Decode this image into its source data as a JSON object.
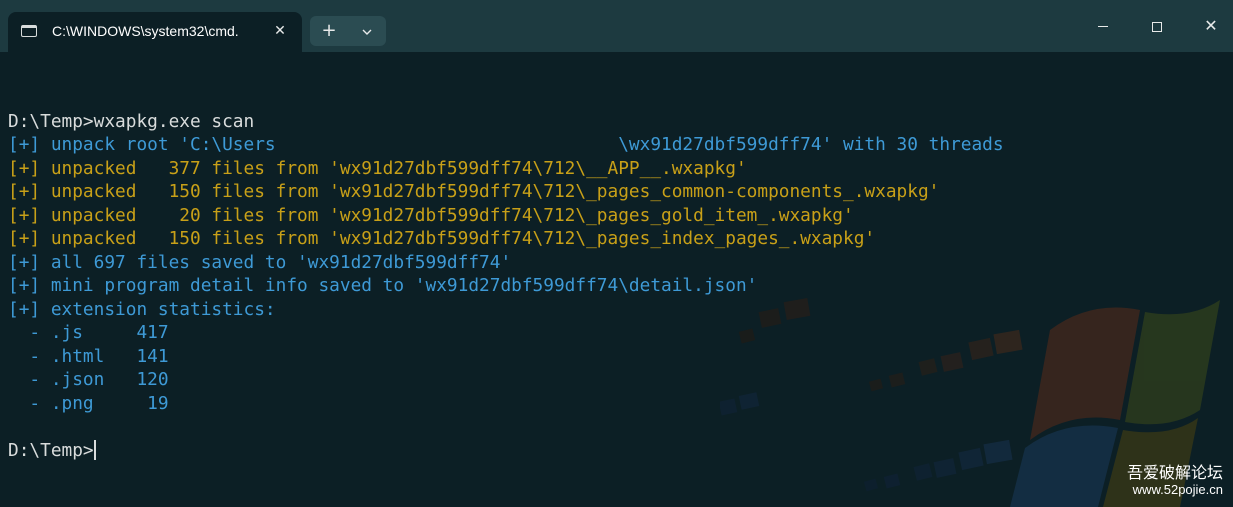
{
  "window": {
    "tab_title": "C:\\WINDOWS\\system32\\cmd.",
    "tab_close_glyph": "✕",
    "new_tab_glyph": "+",
    "dropdown_glyph": "⌄",
    "close_glyph": "✕"
  },
  "terminal": {
    "lines": [
      {
        "text": "",
        "color": "white"
      },
      {
        "text": "D:\\Temp>wxapkg.exe scan",
        "color": "white"
      },
      {
        "text": "[+] unpack root 'C:\\Users                                \\wx91d27dbf599dff74' with 30 threads",
        "color": "blue"
      },
      {
        "text": "[+] unpacked   377 files from 'wx91d27dbf599dff74\\712\\__APP__.wxapkg'",
        "color": "yellow"
      },
      {
        "text": "[+] unpacked   150 files from 'wx91d27dbf599dff74\\712\\_pages_common-components_.wxapkg'",
        "color": "yellow"
      },
      {
        "text": "[+] unpacked    20 files from 'wx91d27dbf599dff74\\712\\_pages_gold_item_.wxapkg'",
        "color": "yellow"
      },
      {
        "text": "[+] unpacked   150 files from 'wx91d27dbf599dff74\\712\\_pages_index_pages_.wxapkg'",
        "color": "yellow"
      },
      {
        "text": "[+] all 697 files saved to 'wx91d27dbf599dff74'",
        "color": "blue"
      },
      {
        "text": "[+] mini program detail info saved to 'wx91d27dbf599dff74\\detail.json'",
        "color": "blue"
      },
      {
        "text": "[+] extension statistics:",
        "color": "blue"
      },
      {
        "text": "  - .js     417",
        "color": "blue"
      },
      {
        "text": "  - .html   141",
        "color": "blue"
      },
      {
        "text": "  - .json   120",
        "color": "blue"
      },
      {
        "text": "  - .png     19",
        "color": "blue"
      },
      {
        "text": "",
        "color": "white"
      },
      {
        "text": "D:\\Temp>",
        "color": "white"
      }
    ]
  },
  "watermark": {
    "site_name": "吾爱破解论坛",
    "url": "www.52pojie.cn"
  },
  "colors": {
    "background": "#0c1f25",
    "titlebar": "#1d3a40",
    "white": "#d9dcdc",
    "blue": "#3e9ad6",
    "yellow": "#c8a018"
  }
}
